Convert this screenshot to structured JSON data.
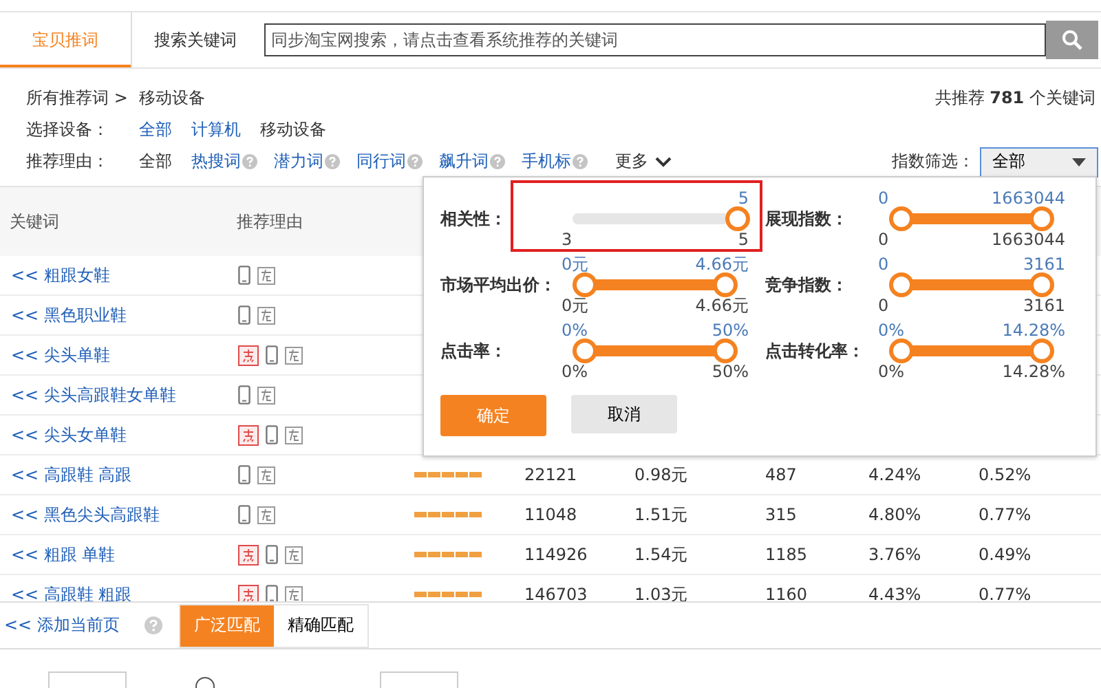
{
  "tabs": [
    {
      "label": "宝贝推词",
      "selected": true
    },
    {
      "label": "搜索关键词",
      "selected": false
    }
  ],
  "search": {
    "placeholder": "同步淘宝网搜索，请点击查看系统推荐的关键词"
  },
  "breadcrumb": [
    "所有推荐词 >",
    "移动设备"
  ],
  "total": "共推荐 **781** 个关键词",
  "device_filter": {
    "label": "选择设备：",
    "options": [
      {
        "label": "全部",
        "selected": false
      },
      {
        "label": "计算机",
        "selected": false
      },
      {
        "label": "移动设备",
        "selected": true
      }
    ]
  },
  "reason_filter": {
    "label": "推荐理由：",
    "options": [
      {
        "label": "全部",
        "selected": true,
        "help": false
      },
      {
        "label": "热搜词",
        "selected": false,
        "help": true
      },
      {
        "label": "潜力词",
        "selected": false,
        "help": true
      },
      {
        "label": "同行词",
        "selected": false,
        "help": true
      },
      {
        "label": "飙升词",
        "selected": false,
        "help": true
      },
      {
        "label": "手机标",
        "selected": false,
        "help": true
      }
    ],
    "more": "更多"
  },
  "index_filter": {
    "label": "指数筛选：",
    "value": "全部"
  },
  "table": {
    "columns": [
      "关键词",
      "推荐理由"
    ],
    "rows": [
      {
        "prefix": "<<",
        "keyword": "粗跟女鞋",
        "hot": false,
        "cells": []
      },
      {
        "prefix": "<<",
        "keyword": "黑色职业鞋",
        "hot": false,
        "cells": []
      },
      {
        "prefix": "<<",
        "keyword": "尖头单鞋",
        "hot": true,
        "cells": []
      },
      {
        "prefix": "<<",
        "keyword": "尖头高跟鞋女单鞋",
        "hot": false,
        "cells": []
      },
      {
        "prefix": "<<",
        "keyword": "尖头女单鞋",
        "hot": true,
        "cells": []
      },
      {
        "prefix": "<<",
        "keyword": "高跟鞋 高跟",
        "hot": false,
        "stars": 5,
        "cells": [
          "22121",
          "0.98元",
          "487",
          "4.24%",
          "0.52%"
        ]
      },
      {
        "prefix": "<<",
        "keyword": "黑色尖头高跟鞋",
        "hot": false,
        "stars": 5,
        "cells": [
          "11048",
          "1.51元",
          "315",
          "4.80%",
          "0.77%"
        ]
      },
      {
        "prefix": "<<",
        "keyword": "粗跟 单鞋",
        "hot": true,
        "stars": 5,
        "cells": [
          "114926",
          "1.54元",
          "1185",
          "3.76%",
          "0.49%"
        ]
      },
      {
        "prefix": "<<",
        "keyword": "高跟鞋 粗跟",
        "hot": true,
        "stars": 5,
        "cells": [
          "146703",
          "1.03元",
          "1160",
          "4.43%",
          "0.77%"
        ]
      }
    ]
  },
  "filter_popup": {
    "sliders": [
      {
        "kind": "single",
        "label": "相关性：",
        "level": 1,
        "top_max": "5",
        "bottom_min": "3",
        "bottom_max": "5",
        "highlighted": true
      },
      {
        "kind": "range",
        "label": "展现指数：",
        "level": 1,
        "top_min": "0",
        "top_max": "1663044",
        "bottom_min": "0",
        "bottom_max": "1663044"
      },
      {
        "kind": "range",
        "label": "市场平均出价：",
        "level": 1,
        "top_min": "0元",
        "top_max": "4.66元",
        "bottom_min": "0元",
        "bottom_max": "4.66元"
      },
      {
        "kind": "range",
        "label": "竞争指数：",
        "level": 1,
        "top_min": "0",
        "top_max": "3161",
        "bottom_min": "0",
        "bottom_max": "3161"
      },
      {
        "kind": "range",
        "label": "点击率：",
        "level": 1,
        "top_min": "0%",
        "top_max": "50%",
        "bottom_min": "0%",
        "bottom_max": "50%"
      },
      {
        "kind": "range",
        "label": "点击转化率：",
        "level": 1,
        "top_min": "0%",
        "top_max": "14.28%",
        "bottom_min": "0%",
        "bottom_max": "14.28%"
      }
    ],
    "confirm": "确定",
    "cancel": "取消"
  },
  "footer": {
    "add_page": "<< 添加当前页",
    "match": [
      {
        "label": "广泛匹配",
        "selected": true
      },
      {
        "label": "精确匹配",
        "selected": false
      }
    ]
  },
  "bottom_row": {
    "radio_checked": false
  }
}
